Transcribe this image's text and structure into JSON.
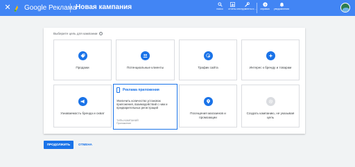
{
  "header": {
    "close_icon": "close-icon",
    "brand": "Google Реклама",
    "title": "Новая кампания",
    "tools": [
      {
        "icon": "search-icon",
        "label": "поиск"
      },
      {
        "icon": "bar-chart-icon",
        "label": "отчеты"
      },
      {
        "icon": "wrench-icon",
        "label": "инструменты и ..."
      },
      {
        "icon": "help-icon",
        "label": "справка"
      },
      {
        "icon": "bell-icon",
        "label": "уведомления"
      }
    ],
    "colors": {
      "bar": "#4285f4",
      "accent": "#1a73e8"
    }
  },
  "main": {
    "prompt": "Выберите цель для кампании",
    "goals": [
      {
        "id": "sales",
        "label": "Продажи",
        "icon": "tag-icon"
      },
      {
        "id": "leads",
        "label": "Потенциальные клиенты",
        "icon": "people-icon"
      },
      {
        "id": "traffic",
        "label": "Трафик сайта",
        "icon": "cursor-icon"
      },
      {
        "id": "consideration",
        "label": "Интерес к бренду и товарам",
        "icon": "sparkle-icon"
      },
      {
        "id": "awareness",
        "label": "Узнаваемость бренда и охват",
        "icon": "megaphone-icon"
      },
      {
        "id": "app",
        "label": "Реклама приложения",
        "icon": "phone-icon",
        "selected": true,
        "description": "Увеличить количество установок приложения, взаимодействий с ним и предварительных регистраций",
        "meta_title": "ТИПЫ КАМПАНИЙ",
        "meta_value": "Приложение"
      },
      {
        "id": "store",
        "label": "Посещения магазинов и промоакции",
        "icon": "pin-icon"
      },
      {
        "id": "no-goal",
        "label": "Создать кампанию, не указывая цель",
        "icon": "gear-icon"
      }
    ]
  },
  "footer": {
    "continue_label": "ПРОДОЛЖИТЬ",
    "cancel_label": "ОТМЕНА"
  }
}
